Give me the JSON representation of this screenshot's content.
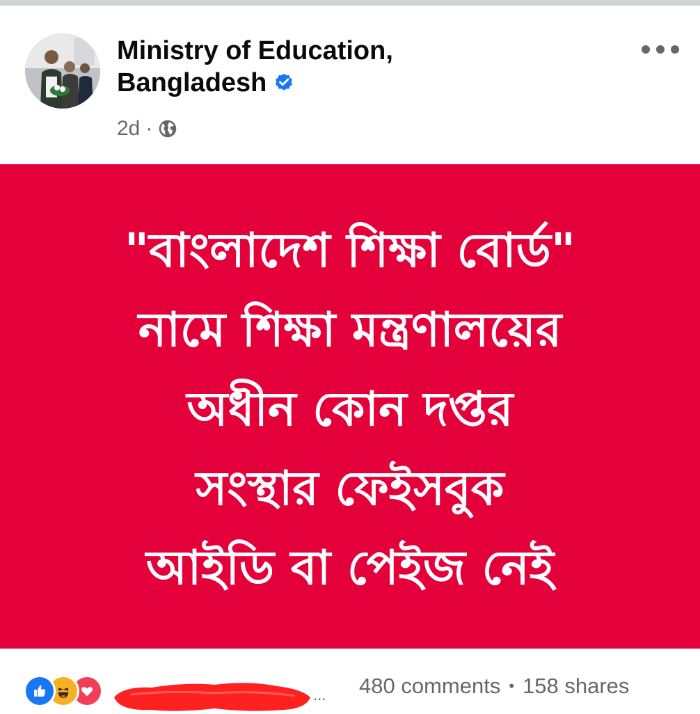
{
  "post": {
    "author": {
      "name_line1": "Ministry of Education,",
      "name_line2": "Bangladesh",
      "verified": true,
      "avatar_icon": "profile-photo"
    },
    "time": "2d",
    "time_separator": "·",
    "audience_icon": "globe-icon",
    "more_icon": "more-options-icon",
    "image": {
      "background": "#e4003a",
      "text_color": "#ffffff",
      "lines": [
        "\"বাংলাদেশ শিক্ষা বোর্ড\"",
        "নামে শিক্ষা মন্ত্রণালয়ের",
        "অধীন কোন দপ্তর",
        "সংস্থার  ফেইসবুক",
        "আইডি বা পেইজ নেই"
      ]
    },
    "footer": {
      "reactions": [
        "like-icon",
        "haha-icon",
        "love-icon"
      ],
      "reaction_names_truncation": "...",
      "comments": "480 comments",
      "separator": "•",
      "shares": "158 shares"
    }
  },
  "colors": {
    "brand_blue": "#1877f2",
    "secondary_text": "#65676b",
    "primary_text": "#0a0a0a"
  }
}
